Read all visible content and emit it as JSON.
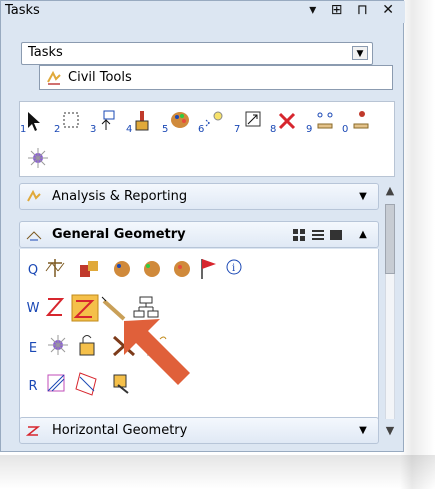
{
  "window": {
    "title": "Tasks",
    "controls": [
      "▾",
      "⊞",
      "⊓",
      "✕"
    ]
  },
  "tasks_combo": {
    "value": "Tasks",
    "arrow": "▼"
  },
  "civil_tools": {
    "label": "Civil Tools",
    "icon": "civil-tools-icon"
  },
  "toolbox": {
    "tools": [
      {
        "name": "select-tool",
        "num": "1"
      },
      {
        "name": "fence-tool",
        "num": "2"
      },
      {
        "name": "place-tool",
        "num": "3"
      },
      {
        "name": "paint-tool",
        "num": "4"
      },
      {
        "name": "palette-tool",
        "num": "5"
      },
      {
        "name": "bulb-tool",
        "num": "6"
      },
      {
        "name": "window-tool",
        "num": "7"
      },
      {
        "name": "delete-tool",
        "num": "8"
      },
      {
        "name": "measure-tool",
        "num": "9"
      },
      {
        "name": "crosshair-tool",
        "num": "0"
      }
    ]
  },
  "sections": {
    "analysis": {
      "label": "Analysis & Reporting",
      "state": "collapsed"
    },
    "general": {
      "label": "General Geometry",
      "state": "expanded"
    },
    "horizontal": {
      "label": "Horizontal Geometry",
      "state": "collapsed"
    }
  },
  "rows": [
    "Q",
    "W",
    "E",
    "R"
  ],
  "colors": {
    "panel": "#dce6f2",
    "accent": "#1a48b5",
    "arrow": "#e0603a"
  }
}
